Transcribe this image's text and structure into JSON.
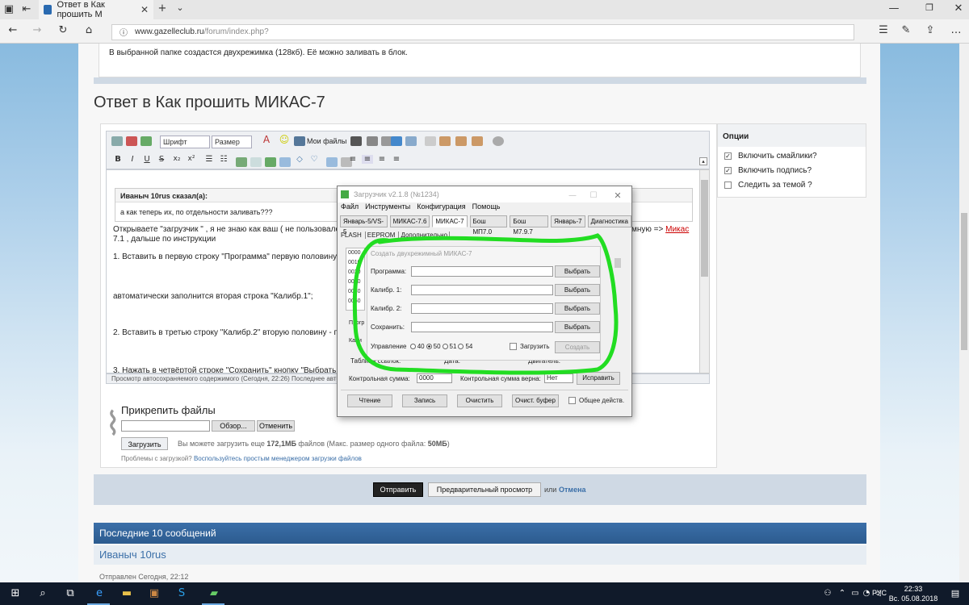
{
  "browser": {
    "tab_title": "Ответ в Как прошить М",
    "url_host": "www.gazelleclub.ru",
    "url_path": "/forum/index.php?"
  },
  "forum": {
    "prev_post_text": "В выбранной папке создастся двухрежимка (128кб). Её можно заливать в блок.",
    "reply_heading": "Ответ в Как прошить МИКАС-7",
    "toolbar": {
      "font_select": "Шрифт",
      "size_select": "Размер",
      "my_files": "Мои файлы"
    },
    "quote_author": "Иваныч 10rus сказал(а):",
    "quote_text": "а как теперь их, по отдельности заливать???",
    "body_lines": [
      "Открываете \"загрузчик \" , я не знаю как ваш ( не пользовало",
      "7.1 , дальше по инструкции",
      "1. Вставить в первую строку \"Программа\" первую половину",
      "автоматически заполнится вторая строка \"Калибр.1\";",
      "2. Вставить в третью строку \"Калибр.2\" вторую половину - п",
      "3. Нажать в четвёртой строке \"Сохранить\" кнопку \"Выбрать"
    ],
    "body_right_text": "мную => ",
    "body_link": "Микас",
    "autosave_status": "Просмотр автосохраняемого содержимого (Сегодня, 22:26)  Последнее авто",
    "options_title": "Опции",
    "options": [
      {
        "label": "Включить смайлики?",
        "checked": true
      },
      {
        "label": "Включить подпись?",
        "checked": true
      },
      {
        "label": "Следить за темой ?",
        "checked": false
      }
    ],
    "attach_title": "Прикрепить файлы",
    "browse_btn": "Обзор...",
    "cancel_btn": "Отменить",
    "upload_btn": "Загрузить",
    "upload_info_pre": "Вы можете загрузить еще ",
    "upload_info_size": "172,1МБ",
    "upload_info_mid": " файлов (Макс. размер одного файла: ",
    "upload_info_max": "50МБ",
    "upload_info_end": ")",
    "problems_text": "Проблемы с загрузкой?",
    "problems_link": "Воспользуйтесь простым менеджером загрузки файлов",
    "submit_btn": "Отправить",
    "preview_btn": "Предварительный просмотр",
    "or_text": "или",
    "cancel_link": "Отмена",
    "last10_title": "Последние 10 сообщений",
    "last_author": "Иваныч 10rus",
    "sent_text": "Отправлен Сегодня, 22:12"
  },
  "dialog": {
    "title": "Загрузчик v2.1.8 (№1234)",
    "menu": [
      "Файл",
      "Инструменты",
      "Конфигурация",
      "Помощь"
    ],
    "tabs": [
      "Январь-5/VS-5",
      "МИКАС-7.6",
      "МИКАС-7",
      "Бош МП7.0",
      "Бош М7.9.7",
      "Январь-7",
      "Диагностика"
    ],
    "subtabs": [
      "FLASH",
      "EEPROM",
      "Дополнительно"
    ],
    "hex_rows": [
      "0000",
      "0010",
      "0020",
      "0030",
      "0040",
      "0050"
    ],
    "inner_caption": "Создать двухрежимный МИКАС-7",
    "rows": [
      {
        "label": "Программа:",
        "button": "Выбрать"
      },
      {
        "label": "Калибр. 1:",
        "button": "Выбрать"
      },
      {
        "label": "Калибр. 2:",
        "button": "Выбрать"
      },
      {
        "label": "Сохранить:",
        "button": "Выбрать"
      }
    ],
    "control_label": "Управление",
    "radios": [
      "40",
      "50",
      "51",
      "54"
    ],
    "load_label": "Загрузить",
    "create_btn": "Создать",
    "hidden_labels": [
      "Прогр",
      "Кали",
      "Таблица ссылок:",
      "Дата:",
      "Двигатель:"
    ],
    "checksum_label": "Контрольная сумма:",
    "checksum_value": "0000",
    "checksum_ok_label": "Контрольная сумма верна:",
    "checksum_ok_value": "Нет",
    "fix_btn": "Исправить",
    "bottom_buttons": [
      "Чтение",
      "Запись",
      "Очистить",
      "Очист. буфер"
    ],
    "common_actions": "Общее действ."
  },
  "taskbar": {
    "lang": "РУС",
    "time": "22:33",
    "date": "Вс. 05.08.2018"
  },
  "colors": {
    "annotation_green": "#22dd22",
    "header_blue": "#2c5b8f",
    "link_blue": "#3b6fa8"
  }
}
